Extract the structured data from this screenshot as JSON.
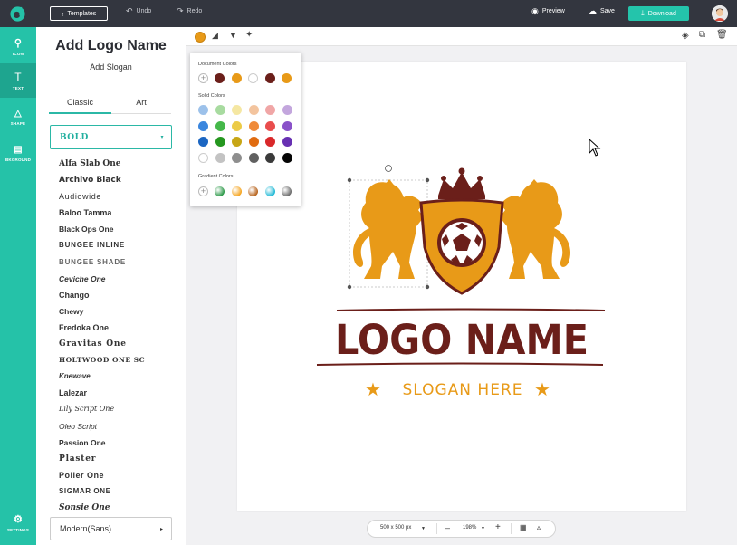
{
  "topbar": {
    "templates_label": "Templates",
    "undo_label": "Undo",
    "redo_label": "Redo",
    "preview_label": "Preview",
    "save_label": "Save",
    "download_label": "Download"
  },
  "nav": {
    "icon_label": "ICON",
    "text_label": "TEXT",
    "shape_label": "SHAPE",
    "background_label": "BKGROUND",
    "settings_label": "SETTINGS"
  },
  "panel": {
    "title": "Add Logo Name",
    "slogan": "Add Slogan",
    "tabs": [
      "Classic",
      "Art"
    ],
    "selected_font": "Bold",
    "fonts": [
      "Alfa Slab One",
      "Archivo Black",
      "Audiowide",
      "Baloo Tamma",
      "Black Ops One",
      "BUNGEE INLINE",
      "BUNGEE SHADE",
      "Ceviche One",
      "Chango",
      "Chewy",
      "Fredoka One",
      "Gravitas One",
      "HOLTWOOD ONE SC",
      "Knewave",
      "Lalezar",
      "Lily Script One",
      "Oleo Script",
      "Passion One",
      "Plaster",
      "Poller One",
      "SIGMAR ONE",
      "Sonsie One"
    ],
    "category": "Modern(Sans)"
  },
  "color_popup": {
    "document_label": "Document Colors",
    "solid_label": "Solid Colors",
    "gradient_label": "Gradient Colors",
    "document_colors": [
      "#6b1f1a",
      "#e89a18",
      "#ffffff",
      "#6b1f1a",
      "#e89a18"
    ],
    "solid_colors": [
      [
        "#9cc1ea",
        "#a8dba0",
        "#f5e7a2",
        "#f3c49e",
        "#f0a6a6",
        "#c3a6dd"
      ],
      [
        "#3a86de",
        "#45b84a",
        "#eccb47",
        "#ef8a39",
        "#e94d4d",
        "#8a52c9"
      ],
      [
        "#1b66c2",
        "#25971f",
        "#c7a615",
        "#e06b10",
        "#d9282a",
        "#6730b2"
      ],
      [
        "#ffffff",
        "#c3c3c3",
        "#8e8e8e",
        "#606060",
        "#3a3a3a",
        "#050505"
      ]
    ],
    "gradient_colors": [
      "#2e9a4a",
      "#f5a623",
      "#b8651f",
      "#20b9d6",
      "#6d6d6d"
    ]
  },
  "logo": {
    "name": "LOGO NAME",
    "slogan": "SLOGAN HERE",
    "name_color": "#6b1f1a",
    "accent_color": "#e89a18"
  },
  "bottom": {
    "canvas_size": "500 x 500 px",
    "zoom": "198%"
  },
  "accent": "#24c4ab"
}
